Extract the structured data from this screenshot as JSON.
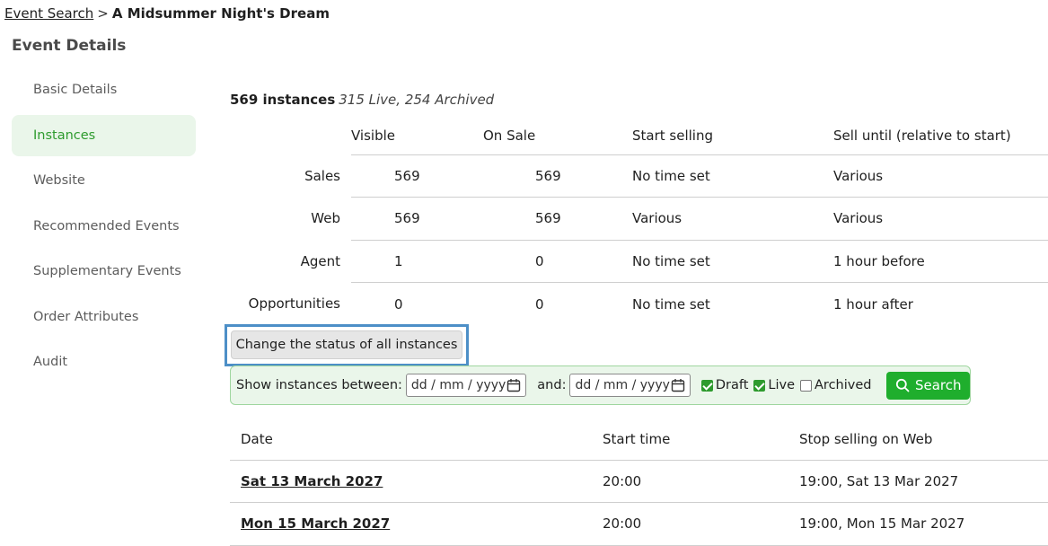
{
  "breadcrumb": {
    "link": "Event Search",
    "separator": ">",
    "current": "A Midsummer Night's Dream"
  },
  "section_title": "Event Details",
  "sidebar": {
    "items": [
      {
        "label": "Basic Details",
        "active": false
      },
      {
        "label": "Instances",
        "active": true
      },
      {
        "label": "Website",
        "active": false
      },
      {
        "label": "Recommended Events",
        "active": false
      },
      {
        "label": "Supplementary Events",
        "active": false
      },
      {
        "label": "Order Attributes",
        "active": false
      },
      {
        "label": "Audit",
        "active": false
      }
    ]
  },
  "summary": {
    "count": "569 instances",
    "detail": "315 Live, 254 Archived"
  },
  "status_table": {
    "headers": [
      "Visible",
      "On Sale",
      "Start selling",
      "Sell until (relative to start)"
    ],
    "rows": [
      {
        "label": "Sales",
        "visible": "569",
        "on_sale": "569",
        "start": "No time set",
        "until": "Various"
      },
      {
        "label": "Web",
        "visible": "569",
        "on_sale": "569",
        "start": "Various",
        "until": "Various"
      },
      {
        "label": "Agent",
        "visible": "1",
        "on_sale": "0",
        "start": "No time set",
        "until": "1 hour before"
      },
      {
        "label": "Opportunities",
        "visible": "0",
        "on_sale": "0",
        "start": "No time set",
        "until": "1 hour after"
      }
    ]
  },
  "change_status_label": "Change the status of all instances",
  "filter": {
    "label_between": "Show instances between:",
    "from_placeholder": "dd / mm / yyyy",
    "label_and": "and:",
    "to_placeholder": "dd / mm / yyyy",
    "checkboxes": [
      {
        "label": "Draft",
        "checked": true
      },
      {
        "label": "Live",
        "checked": true
      },
      {
        "label": "Archived",
        "checked": false
      }
    ],
    "search_label": "Search"
  },
  "instances_table": {
    "headers": [
      "Date",
      "Start time",
      "Stop selling on Web"
    ],
    "rows": [
      {
        "date": "Sat 13 March 2027",
        "start": "20:00",
        "stop": "19:00, Sat 13 Mar 2027"
      },
      {
        "date": "Mon 15 March 2027",
        "start": "20:00",
        "stop": "19:00, Mon 15 Mar 2027"
      }
    ]
  },
  "colors": {
    "accent": "#1fae2d",
    "active_bg": "#eaf6ea",
    "focus_outline": "#4d8fc7"
  }
}
